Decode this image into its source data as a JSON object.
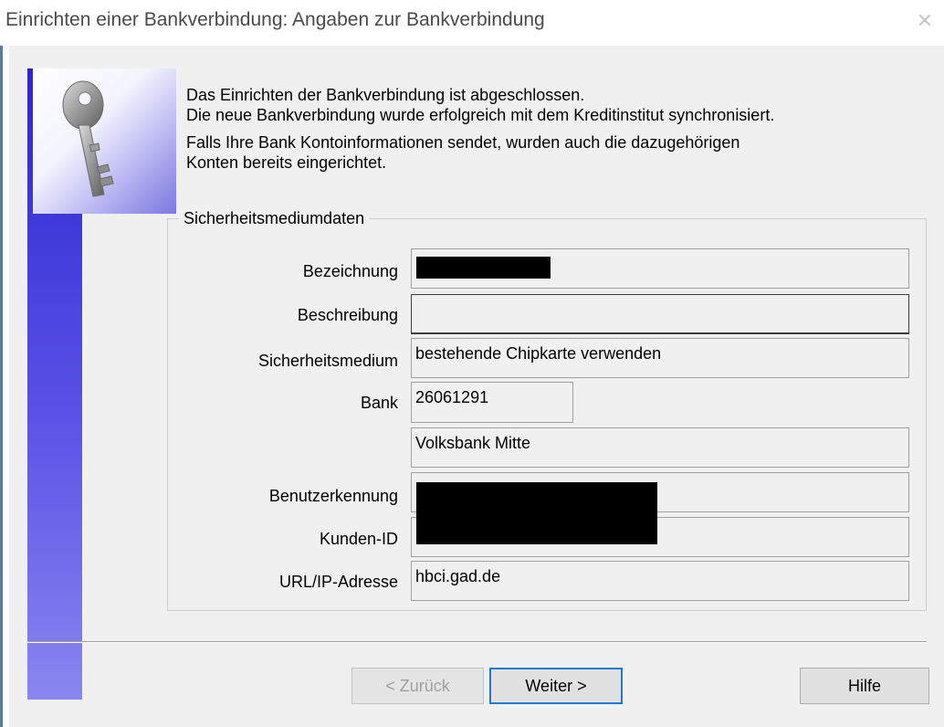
{
  "window": {
    "title": "Einrichten einer Bankverbindung: Angaben zur Bankverbindung",
    "close_icon": "close-icon"
  },
  "intro": {
    "line1": "Das Einrichten der Bankverbindung ist abgeschlossen.",
    "line2": "Die neue Bankverbindung wurde erfolgreich mit dem Kreditinstitut synchronisiert.",
    "line3": "Falls Ihre Bank Kontoinformationen sendet, wurden auch die dazugehörigen",
    "line4": "Konten bereits eingerichtet."
  },
  "group": {
    "title": "Sicherheitsmediumdaten",
    "fields": {
      "bezeichnung": {
        "label": "Bezeichnung",
        "value": "",
        "redacted": true
      },
      "beschreibung": {
        "label": "Beschreibung",
        "value": ""
      },
      "sicherheitsmedium": {
        "label": "Sicherheitsmedium",
        "value": "bestehende Chipkarte verwenden"
      },
      "bank": {
        "label": "Bank",
        "value": "26061291",
        "name": "Volksbank Mitte"
      },
      "benutzerkennung": {
        "label": "Benutzerkennung",
        "value": "",
        "redacted": true
      },
      "kunden_id": {
        "label": "Kunden-ID",
        "value": "",
        "redacted": true
      },
      "url": {
        "label": "URL/IP-Adresse",
        "value": "hbci.gad.de"
      }
    }
  },
  "buttons": {
    "back": "< Zurück",
    "next": "Weiter >",
    "help": "Hilfe"
  },
  "colors": {
    "banner": "#2b25cf",
    "focus_border": "#1e78d7",
    "dialog_bg": "#f0f0f0"
  },
  "icons": {
    "banner_icon": "key-icon"
  }
}
